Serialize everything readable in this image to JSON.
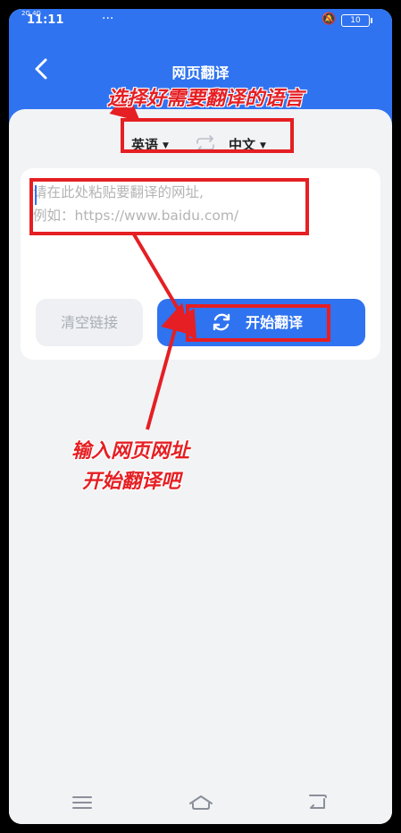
{
  "status_bar": {
    "signal": "2G 4G",
    "time": "11:11",
    "dots": "···",
    "battery": "10"
  },
  "header": {
    "title": "网页翻译"
  },
  "language_bar": {
    "source": "英语",
    "target": "中文"
  },
  "url_input": {
    "placeholder": "请在此处粘贴要翻译的网址,\n例如：https://www.baidu.com/",
    "value": ""
  },
  "buttons": {
    "clear": "清空链接",
    "start": "开始翻译"
  },
  "annotations": {
    "top": "选择好需要翻译的语言",
    "bottom_line1": "输入网页网址",
    "bottom_line2": "开始翻译吧"
  },
  "colors": {
    "brand": "#2f73f0",
    "annotation": "#e51f23",
    "background": "#f2f3f5"
  }
}
